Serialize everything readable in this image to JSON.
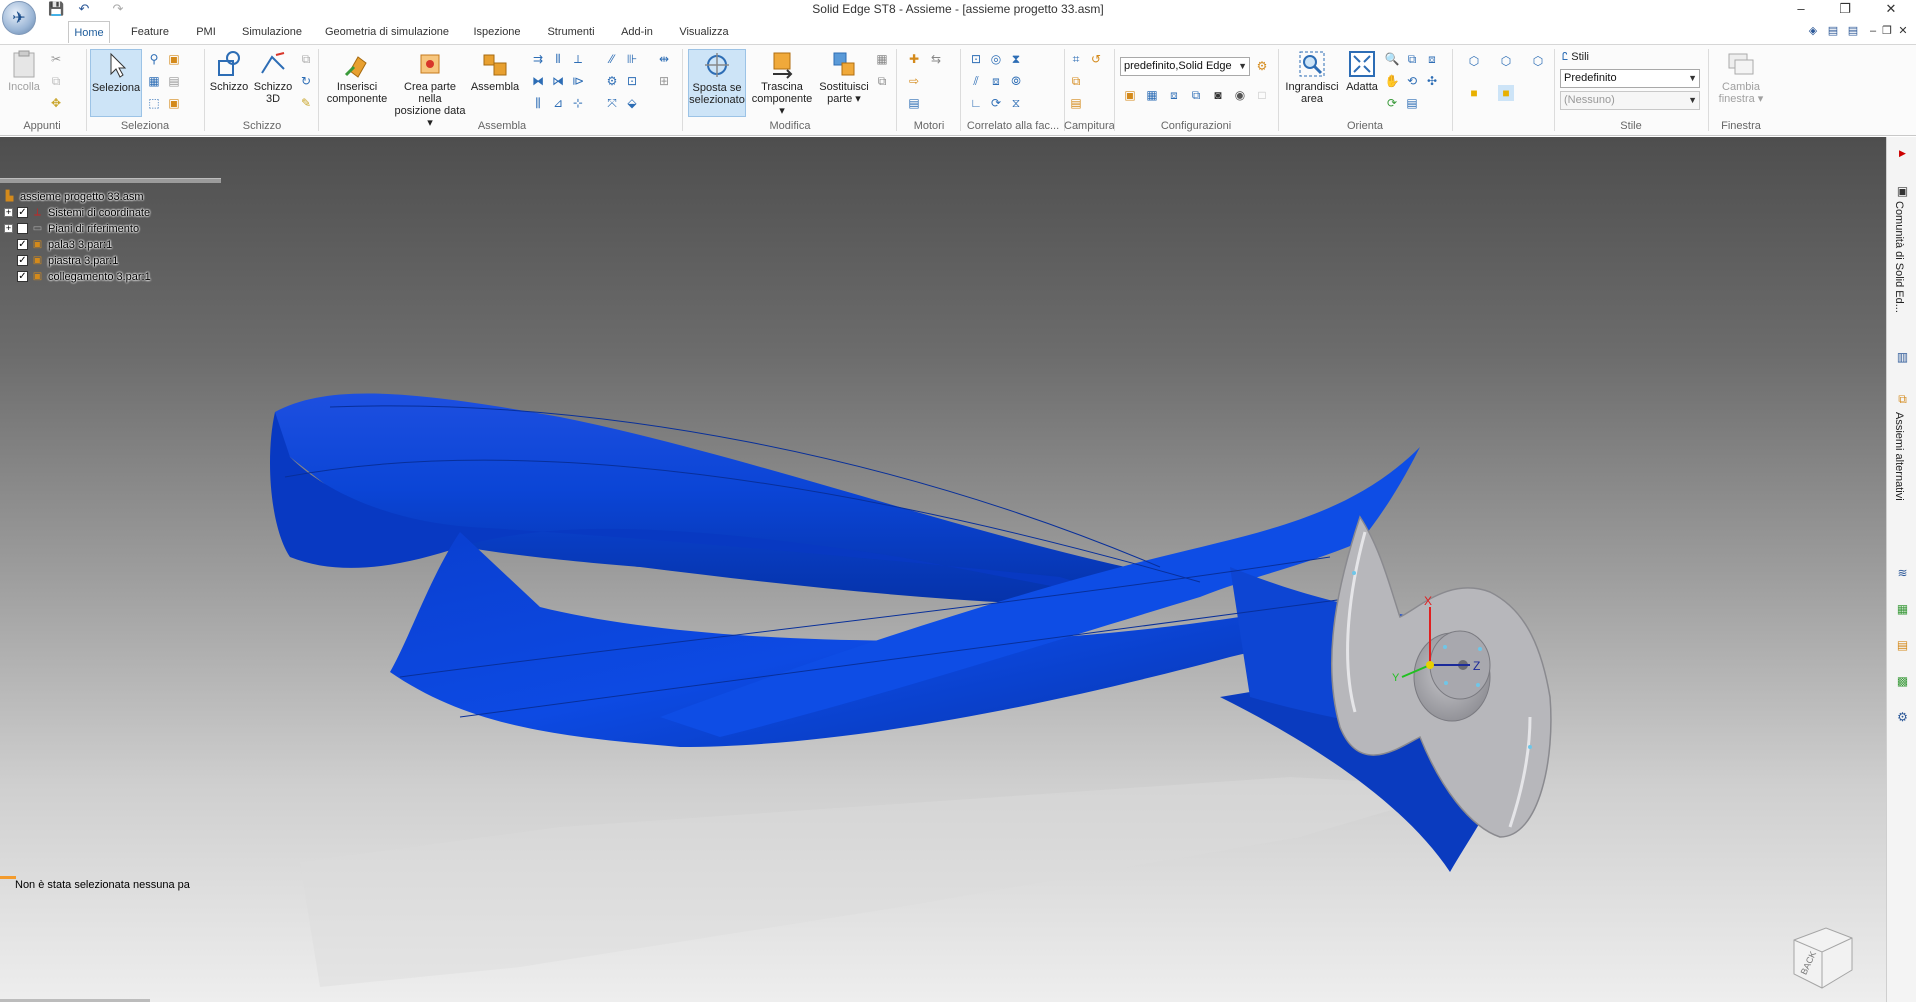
{
  "window": {
    "title": "Solid Edge ST8 - Assieme - [assieme progetto 33.asm]"
  },
  "tabs": [
    "Home",
    "Feature",
    "PMI",
    "Simulazione",
    "Geometria di simulazione",
    "Ispezione",
    "Strumenti",
    "Add-in",
    "Visualizza"
  ],
  "ribbon": {
    "appunti": {
      "label": "Appunti",
      "incolla": "Incolla"
    },
    "seleziona": {
      "label": "Seleziona",
      "button": "Seleziona"
    },
    "schizzo": {
      "label": "Schizzo",
      "schizzo": "Schizzo",
      "schizzo3d_1": "Schizzo",
      "schizzo3d_2": "3D"
    },
    "assembla": {
      "label": "Assembla",
      "inserisci_1": "Inserisci",
      "inserisci_2": "componente",
      "crea_1": "Crea parte nella",
      "crea_2": "posizione data",
      "assembla": "Assembla"
    },
    "modifica": {
      "label": "Modifica",
      "sposta_1": "Sposta se",
      "sposta_2": "selezionato",
      "trascina_1": "Trascina",
      "trascina_2": "componente",
      "sostituisci_1": "Sostituisci",
      "sostituisci_2": "parte"
    },
    "motori": {
      "label": "Motori"
    },
    "correlato": {
      "label": "Correlato alla fac..."
    },
    "campitura": {
      "label": "Campitura"
    },
    "configurazioni": {
      "label": "Configurazioni",
      "combo": "predefinito,Solid Edge"
    },
    "orienta": {
      "label": "Orienta",
      "ingrandisci_1": "Ingrandisci",
      "ingrandisci_2": "area",
      "adatta": "Adatta"
    },
    "stile": {
      "label": "Stile",
      "stili": "Stili",
      "combo1": "Predefinito",
      "combo2": "(Nessuno)"
    },
    "finestra": {
      "label": "Finestra",
      "cambia_1": "Cambia",
      "cambia_2": "finestra"
    }
  },
  "tree": {
    "root": "assieme progetto 33.asm",
    "items": [
      {
        "label": "Sistemi di coordinate",
        "expandable": true,
        "checked": true
      },
      {
        "label": "Piani di riferimento",
        "expandable": true,
        "checked": false
      },
      {
        "label": "pala3 3.par:1",
        "expandable": false,
        "checked": true
      },
      {
        "label": "piastra 3.par:1",
        "expandable": false,
        "checked": true
      },
      {
        "label": "collegamento 3.par:1",
        "expandable": false,
        "checked": true
      }
    ]
  },
  "status": {
    "message": "Non è stata selezionata nessuna pa"
  },
  "viewcube": {
    "face": "BACK"
  },
  "triad": {
    "x": "X",
    "y": "Y",
    "z": "Z"
  },
  "dock": {
    "community": "Comunità di Solid Ed...",
    "assiemi": "Assiemi alternativi"
  },
  "colors": {
    "accent": "#1e5c9b",
    "blade": "#0a3fd0",
    "hub": "#b4b4b8"
  }
}
